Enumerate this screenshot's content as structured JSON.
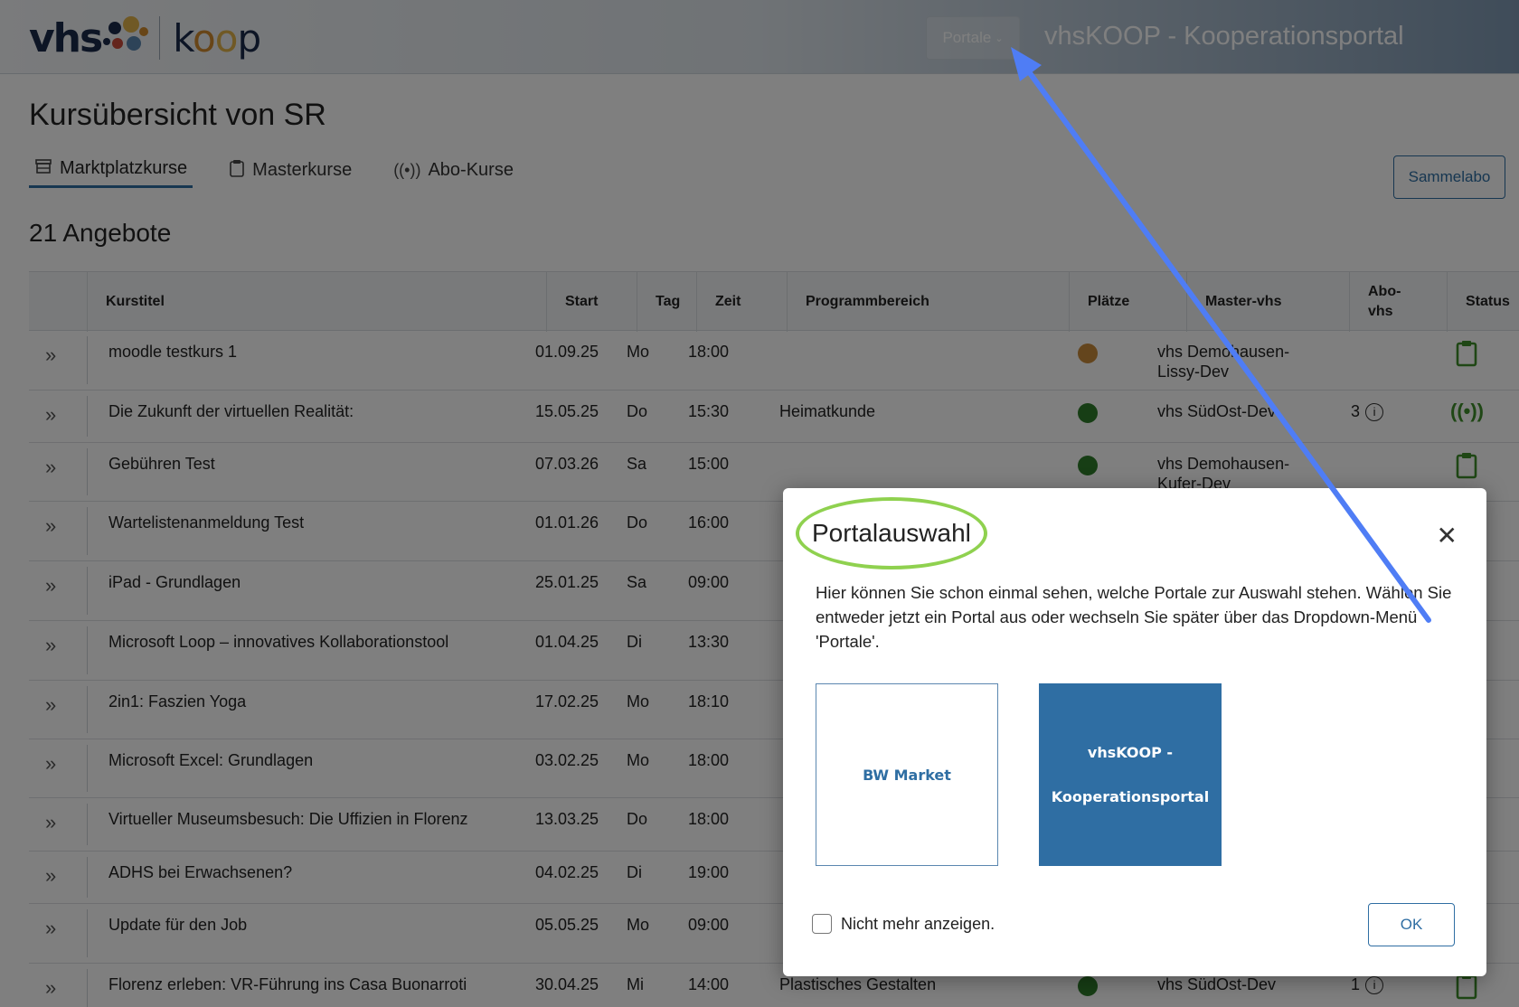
{
  "header": {
    "logo_vhs": "vhs",
    "logo_koop": [
      "k",
      "o",
      "o",
      "p"
    ],
    "portale_label": "Portale",
    "portal_title": "vhsKOOP - Kooperationsportal"
  },
  "page": {
    "title": "Kursübersicht von SR",
    "tabs": [
      {
        "label": "Marktplatzkurse",
        "icon": "storefront-icon",
        "active": true
      },
      {
        "label": "Masterkurse",
        "icon": "clipboard-icon",
        "active": false
      },
      {
        "label": "Abo-Kurse",
        "icon": "broadcast-icon",
        "active": false
      }
    ],
    "sammelabo_label": "Sammelabo",
    "count": "21 Angebote"
  },
  "table": {
    "headers": [
      "Kurstitel",
      "Start",
      "Tag",
      "Zeit",
      "Programmbereich",
      "Plätze",
      "Master-vhs",
      "Abo-vhs",
      "Status"
    ],
    "header_abo_lines": [
      "Abo-",
      "vhs"
    ],
    "rows": [
      {
        "title": "moodle testkurs 1",
        "start": "01.09.25",
        "day": "Mo",
        "time": "18:00",
        "area": "",
        "dot": "#c98a3a",
        "master": [
          "vhs Demohausen-",
          "Lissy-Dev"
        ],
        "abo": "",
        "status": "clipboard-icon"
      },
      {
        "title": "Die Zukunft der virtuellen Realität:",
        "start": "15.05.25",
        "day": "Do",
        "time": "15:30",
        "area": "Heimatkunde",
        "dot": "#2f7d2a",
        "master": [
          "vhs SüdOst-Dev",
          ""
        ],
        "abo": "3",
        "status": "broadcast-icon"
      },
      {
        "title": "Gebühren Test",
        "start": "07.03.26",
        "day": "Sa",
        "time": "15:00",
        "area": "",
        "dot": "#2f7d2a",
        "master": [
          "vhs Demohausen-",
          "Kufer-Dev"
        ],
        "abo": "",
        "status": "clipboard-icon"
      },
      {
        "title": "Wartelistenanmeldung Test",
        "start": "01.01.26",
        "day": "Do",
        "time": "16:00",
        "area": "",
        "dot": "",
        "master": [
          "",
          ""
        ],
        "abo": "",
        "status": ""
      },
      {
        "title": "iPad - Grundlagen",
        "start": "25.01.25",
        "day": "Sa",
        "time": "09:00",
        "area": "",
        "dot": "",
        "master": [
          "",
          ""
        ],
        "abo": "",
        "status": ""
      },
      {
        "title": "Microsoft Loop – innovatives Kollaborationstool",
        "start": "01.04.25",
        "day": "Di",
        "time": "13:30",
        "area": "",
        "dot": "",
        "master": [
          "",
          ""
        ],
        "abo": "",
        "status": ""
      },
      {
        "title": "2in1: Faszien Yoga",
        "start": "17.02.25",
        "day": "Mo",
        "time": "18:10",
        "area": "",
        "dot": "",
        "master": [
          "",
          ""
        ],
        "abo": "",
        "status": ""
      },
      {
        "title": "Microsoft Excel: Grundlagen",
        "start": "03.02.25",
        "day": "Mo",
        "time": "18:00",
        "area": "",
        "dot": "",
        "master": [
          "",
          ""
        ],
        "abo": "",
        "status": ""
      },
      {
        "title": "Virtueller Museumsbesuch: Die Uffizien in Florenz",
        "start": "13.03.25",
        "day": "Do",
        "time": "18:00",
        "area": "",
        "dot": "",
        "master": [
          "",
          ""
        ],
        "abo": "",
        "status": ""
      },
      {
        "title": "ADHS bei Erwachsenen?",
        "start": "04.02.25",
        "day": "Di",
        "time": "19:00",
        "area": "",
        "dot": "",
        "master": [
          "",
          ""
        ],
        "abo": "",
        "status": ""
      },
      {
        "title": "Update für den Job",
        "start": "05.05.25",
        "day": "Mo",
        "time": "09:00",
        "area": "",
        "dot": "",
        "master": [
          "",
          ""
        ],
        "abo": "",
        "status": ""
      },
      {
        "title": "Florenz erleben: VR-Führung ins Casa Buonarroti",
        "start": "30.04.25",
        "day": "Mi",
        "time": "14:00",
        "area": "Plastisches Gestalten",
        "dot": "#2f7d2a",
        "master": [
          "vhs SüdOst-Dev",
          ""
        ],
        "abo": "1",
        "status": "clipboard-icon"
      }
    ]
  },
  "modal": {
    "title": "Portalauswahl",
    "text": "Hier können Sie schon einmal sehen, welche Portale zur Auswahl stehen. Wählen Sie entweder jetzt ein Portal aus oder wechseln Sie später über das Dropdown-Menü 'Portale'.",
    "portals": [
      "BW Market",
      "vhsKOOP -\nKooperationsportal"
    ],
    "portal_koop_lines": [
      "vhsKOOP -",
      "Kooperationsportal"
    ],
    "checkbox_label": "Nicht mehr anzeigen.",
    "ok_label": "OK"
  },
  "colors": {
    "accent": "#2f6ea3",
    "status_green": "#3e8e2b",
    "dot_orange": "#c98a3a",
    "dot_green": "#2f7d2a",
    "highlight_ring": "#8fd14f",
    "annotation_arrow": "#4f7df5"
  }
}
